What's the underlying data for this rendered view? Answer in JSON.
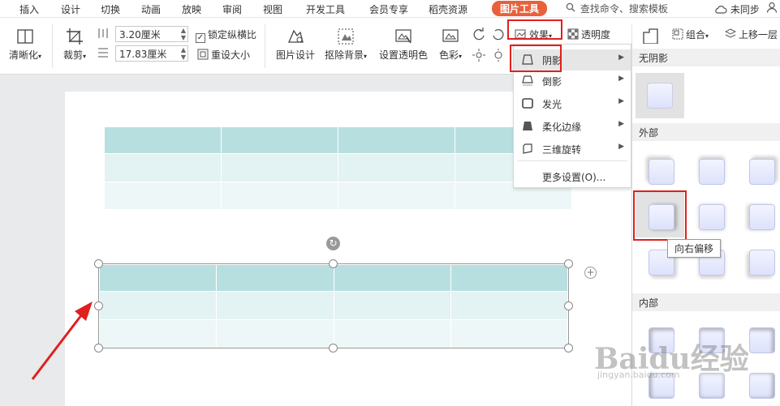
{
  "menubar": {
    "tabs": [
      {
        "label": "插入",
        "active": false
      },
      {
        "label": "设计",
        "active": false
      },
      {
        "label": "切换",
        "active": false
      },
      {
        "label": "动画",
        "active": false
      },
      {
        "label": "放映",
        "active": false
      },
      {
        "label": "审阅",
        "active": false
      },
      {
        "label": "视图",
        "active": false
      },
      {
        "label": "开发工具",
        "active": false
      },
      {
        "label": "会员专享",
        "active": false
      },
      {
        "label": "稻壳资源",
        "active": false
      },
      {
        "label": "图片工具",
        "active": true
      }
    ],
    "search_text": "查找命令、搜索模板",
    "sync_status": "未同步"
  },
  "ribbon": {
    "clarity": "清晰化",
    "crop": "裁剪",
    "width_value": "3.20厘米",
    "height_value": "17.83厘米",
    "lock_ratio": "锁定纵横比",
    "lock_ratio_checked": true,
    "reset_size": "重设大小",
    "picture_design": "图片设计",
    "remove_bg": "抠除背景",
    "set_transparent": "设置透明色",
    "color": "色彩",
    "effect": "效果",
    "transparency": "透明度",
    "group": "组合",
    "bring_forward": "上移一层"
  },
  "effect_menu": {
    "items": [
      {
        "label": "阴影",
        "submenu": true,
        "active": true
      },
      {
        "label": "倒影",
        "submenu": true,
        "active": false
      },
      {
        "label": "发光",
        "submenu": true,
        "active": false
      },
      {
        "label": "柔化边缘",
        "submenu": true,
        "active": false
      },
      {
        "label": "三维旋转",
        "submenu": true,
        "active": false
      }
    ],
    "more_settings": "更多设置(O)..."
  },
  "shadow_panel": {
    "no_shadow": "无阴影",
    "outer": "外部",
    "inner": "内部",
    "tooltip": "向右偏移"
  },
  "watermark": {
    "main": "Baidu经验",
    "sub": "jingyan.baidu.com"
  },
  "colors": {
    "accent": "#e8613b",
    "highlight": "#e0201e",
    "table_header": "#b8dfe0",
    "table_row": "#e3f2f2"
  }
}
